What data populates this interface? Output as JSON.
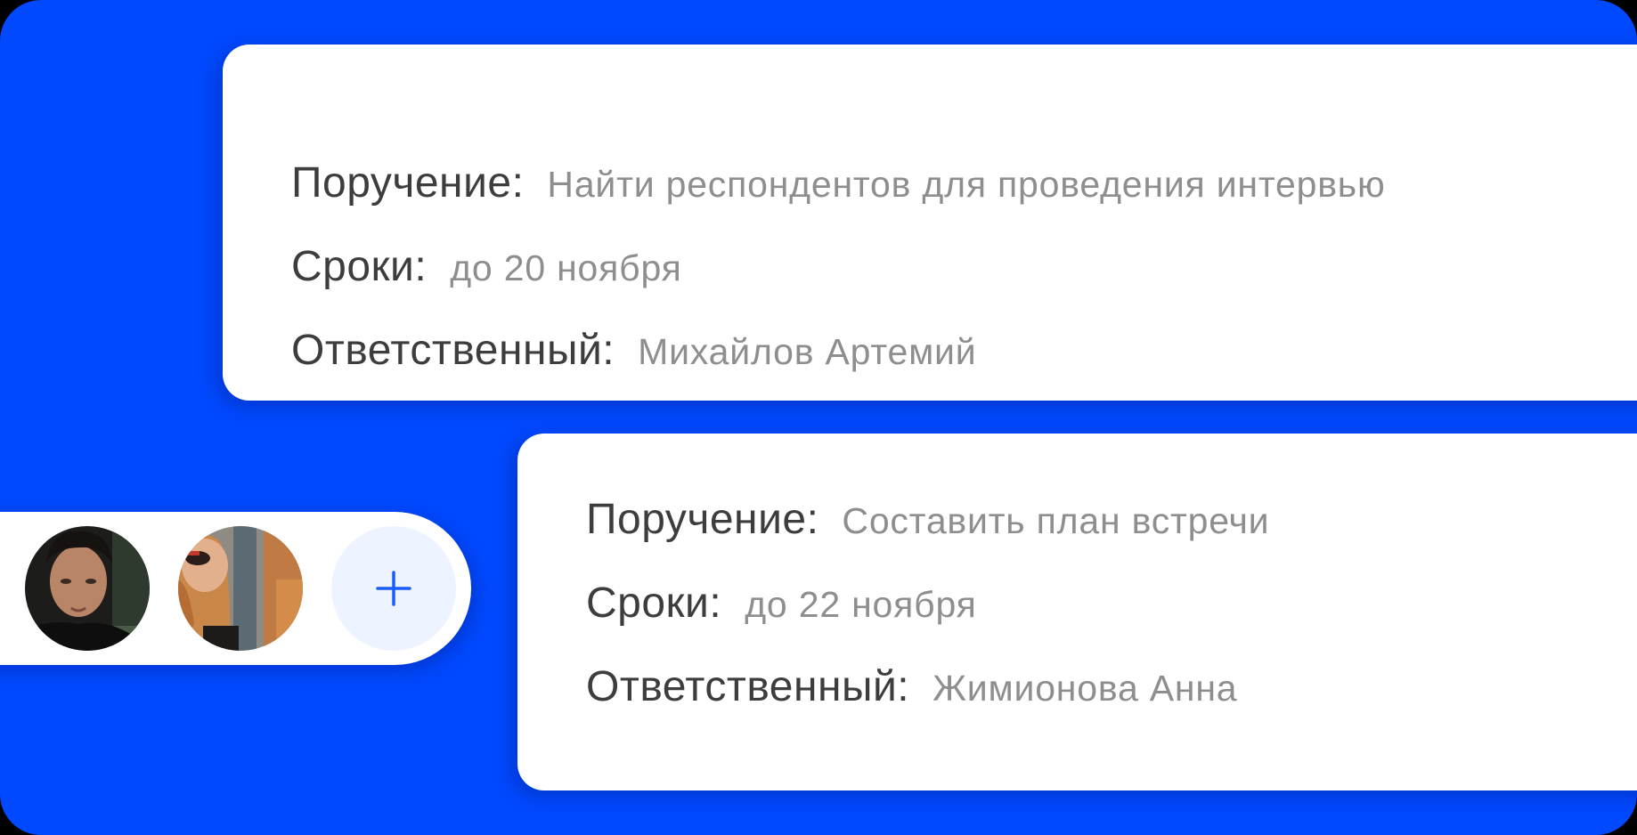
{
  "tasks": [
    {
      "assignment_label": "Поручение:",
      "assignment_value": "Найти респондентов для проведения интервью",
      "deadline_label": "Сроки:",
      "deadline_value": "до 20 ноября",
      "responsible_label": "Ответственный:",
      "responsible_value": "Михайлов Артемий"
    },
    {
      "assignment_label": "Поручение:",
      "assignment_value": "Составить план встречи",
      "deadline_label": "Сроки:",
      "deadline_value": "до 22 ноября",
      "responsible_label": "Ответственный:",
      "responsible_value": "Жимионова Анна"
    }
  ],
  "participants": {
    "avatars": [
      "avatar",
      "avatar"
    ],
    "add_icon": "plus-icon"
  },
  "colors": {
    "background": "#0049ff",
    "card": "#ffffff",
    "label_text": "#3d3d3d",
    "value_text": "#8e8e8e",
    "accent": "#1a5cff",
    "add_button_bg": "#eef4ff"
  }
}
